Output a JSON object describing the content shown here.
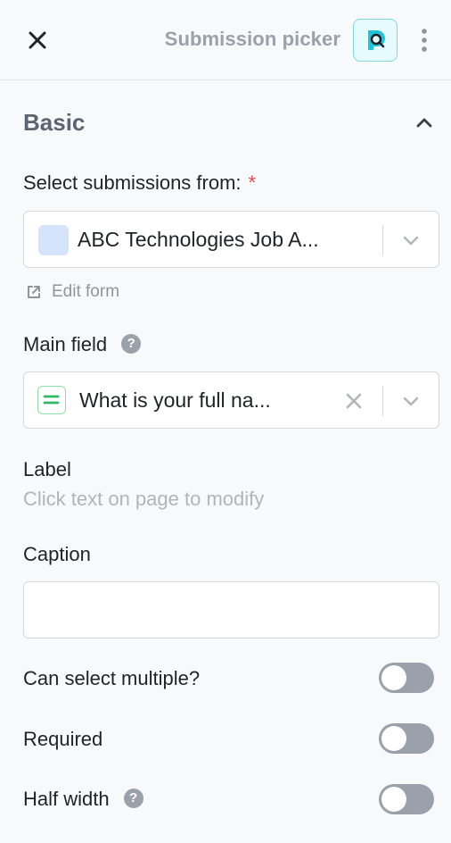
{
  "header": {
    "title": "Submission picker",
    "close_icon": "close-icon",
    "app_icon": "submission-picker-icon",
    "more_icon": "more-vertical-icon",
    "accent_color": "#22c3d6"
  },
  "section": {
    "title": "Basic",
    "toggle_icon": "chevron-up-icon"
  },
  "select_from": {
    "label": "Select submissions from:",
    "required_mark": "*",
    "value": "ABC Technologies Job A...",
    "swatch_color": "#d5e3fb",
    "edit_link": "Edit form",
    "edit_icon": "external-link-icon"
  },
  "main_field": {
    "label": "Main field",
    "help_icon": "question-icon",
    "value": "What is your full na...",
    "type_icon": "text-field-icon",
    "clear_icon": "close-icon"
  },
  "label_field": {
    "label": "Label",
    "hint": "Click text on page to modify"
  },
  "caption": {
    "label": "Caption",
    "value": "",
    "placeholder": ""
  },
  "toggles": [
    {
      "label": "Can select multiple?",
      "on": false,
      "help": false
    },
    {
      "label": "Required",
      "on": false,
      "help": false
    },
    {
      "label": "Half width",
      "on": false,
      "help": true
    }
  ]
}
